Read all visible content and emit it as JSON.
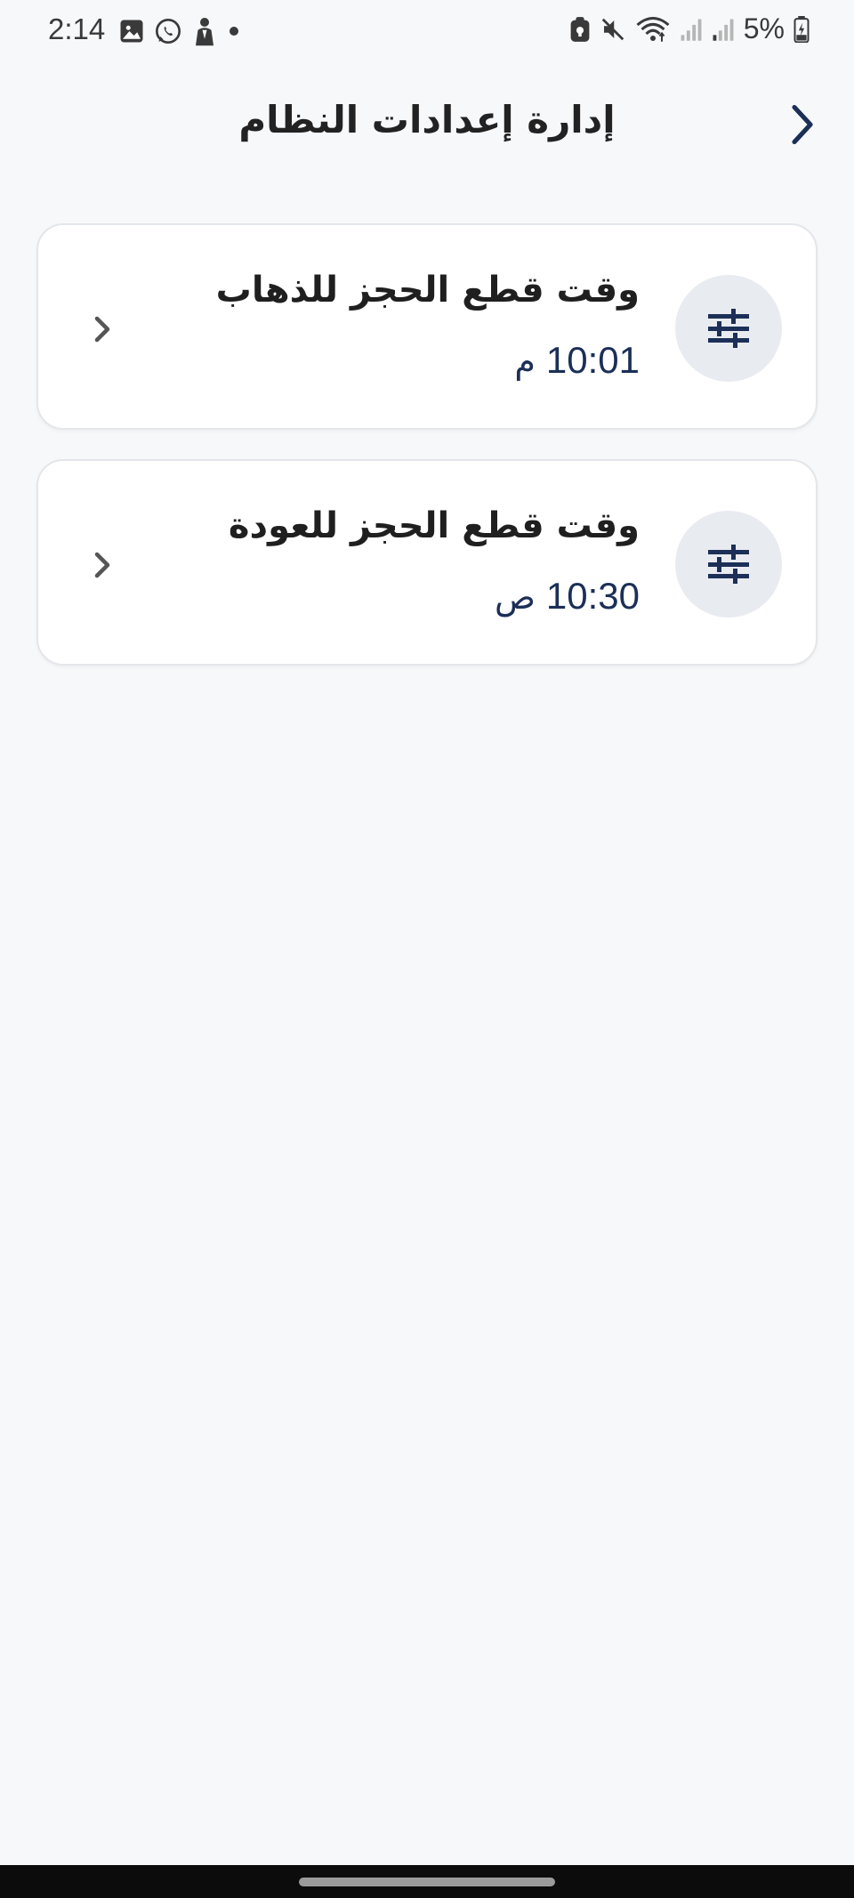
{
  "status_bar": {
    "time": "2:14",
    "battery": "5%",
    "left_icons": [
      "image-icon",
      "whatsapp-icon",
      "person-icon",
      "dot-icon"
    ],
    "right_icons": [
      "lock-icon",
      "mute-icon",
      "wifi-icon",
      "signal-icon",
      "signal-icon",
      "battery-icon"
    ]
  },
  "header": {
    "title": "إدارة إعدادات النظام",
    "back_icon": "chevron-right-icon"
  },
  "settings": [
    {
      "title": "وقت قطع الحجز للذهاب",
      "time": "10:01",
      "period": "م",
      "icon": "tune-icon",
      "chevron": "chevron-left-icon"
    },
    {
      "title": "وقت قطع الحجز للعودة",
      "time": "10:30",
      "period": "ص",
      "icon": "tune-icon",
      "chevron": "chevron-left-icon"
    }
  ],
  "colors": {
    "background": "#f7f8fa",
    "card": "#ffffff",
    "accent": "#1b2f57",
    "icon_circle": "#e8ebf0"
  }
}
